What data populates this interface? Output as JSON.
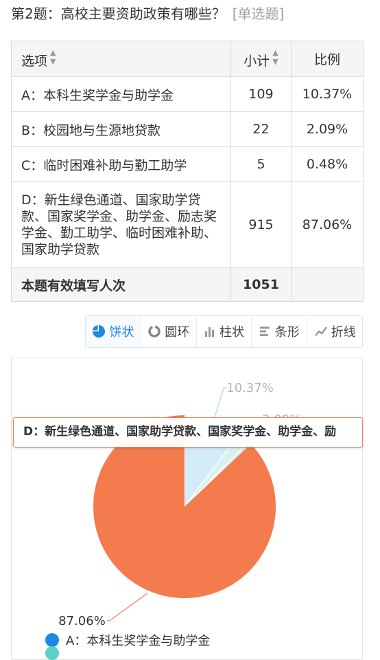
{
  "question": {
    "title": "第2题：高校主要资助政策有哪些？",
    "type": "[单选题]"
  },
  "table": {
    "headers": {
      "option": "选项",
      "count": "小计",
      "ratio": "比例"
    },
    "rows": [
      {
        "option": "A：本科生奖学金与助学金",
        "count": "109",
        "ratio": "10.37%"
      },
      {
        "option": "B：校园地与生源地贷款",
        "count": "22",
        "ratio": "2.09%"
      },
      {
        "option": "C：临时困难补助与勤工助学",
        "count": "5",
        "ratio": "0.48%"
      },
      {
        "option": "D：新生绿色通道、国家助学贷款、国家奖学金、助学金、励志奖学金、勤工助学、临时困难补助、国家助学贷款",
        "count": "915",
        "ratio": "87.06%"
      }
    ],
    "total": {
      "label": "本题有效填写人次",
      "count": "1051"
    }
  },
  "chart_tabs": [
    {
      "label": "饼状",
      "icon": "pie-icon",
      "active": true
    },
    {
      "label": "圆环",
      "icon": "ring-icon",
      "active": false
    },
    {
      "label": "柱状",
      "icon": "bar-icon",
      "active": false
    },
    {
      "label": "条形",
      "icon": "hbar-icon",
      "active": false
    },
    {
      "label": "折线",
      "icon": "line-icon",
      "active": false
    }
  ],
  "tooltip": {
    "text": "D：新生绿色通道、国家助学贷款、国家奖学金、助学金、励"
  },
  "legend": [
    {
      "label": "A：本科生奖学金与助学金",
      "color": "#1e88e5"
    }
  ],
  "chart_data": {
    "type": "pie",
    "categories": [
      "A：本科生奖学金与助学金",
      "B：校园地与生源地贷款",
      "C：临时困难补助与勤工助学",
      "D：新生绿色通道、国家助学贷款、国家奖学金、助学金、励志奖学金、勤工助学、临时困难补助、国家助学贷款"
    ],
    "values": [
      10.37,
      2.09,
      0.48,
      87.06
    ],
    "labels": [
      "10.37%",
      "2.09%",
      "",
      "87.06%"
    ],
    "colors": [
      "#d4ebfa",
      "#d7f1ee",
      "#cfe9d4",
      "#f47b4e"
    ],
    "highlighted": "D：新生绿色通道、国家助学贷款、国家奖学金、助学金、励志奖学金、勤工助学、临时困难补助、国家助学贷款"
  },
  "colors": {
    "accent": "#1e88e5",
    "highlight_slice": "#f47b4e"
  }
}
